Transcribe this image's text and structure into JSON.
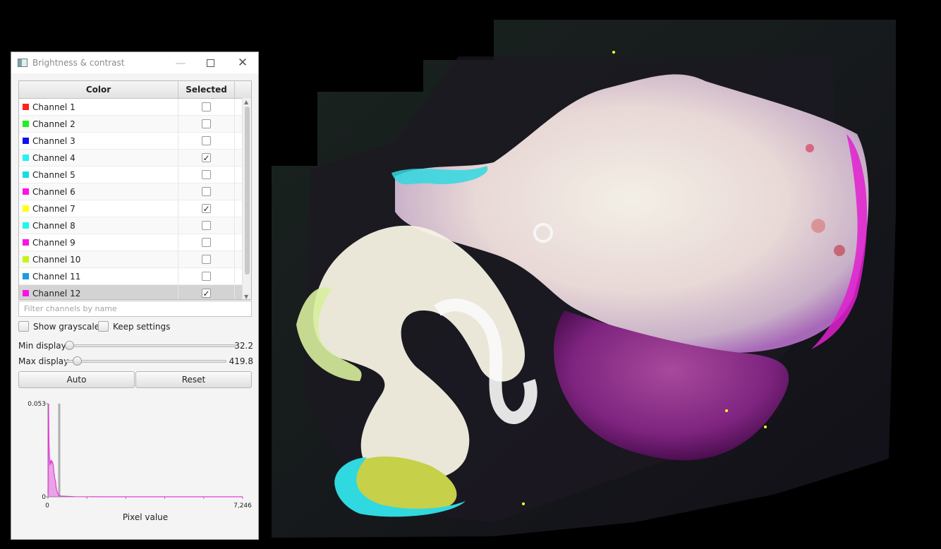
{
  "dialog": {
    "title": "Brightness & contrast",
    "minimize_icon": "minimize-icon",
    "maximize_icon": "maximize-icon",
    "close_icon": "close-icon",
    "table": {
      "headers": {
        "color": "Color",
        "selected": "Selected"
      },
      "rows": [
        {
          "name": "Channel 1",
          "color": "#ff2020",
          "selected": false
        },
        {
          "name": "Channel 2",
          "color": "#22ee22",
          "selected": false
        },
        {
          "name": "Channel 3",
          "color": "#1010ee",
          "selected": false
        },
        {
          "name": "Channel 4",
          "color": "#22f2f2",
          "selected": true
        },
        {
          "name": "Channel 5",
          "color": "#16dede",
          "selected": false
        },
        {
          "name": "Channel 6",
          "color": "#ff10e6",
          "selected": false
        },
        {
          "name": "Channel 7",
          "color": "#ffff10",
          "selected": true
        },
        {
          "name": "Channel 8",
          "color": "#22f5ee",
          "selected": false
        },
        {
          "name": "Channel 9",
          "color": "#ff10e6",
          "selected": false
        },
        {
          "name": "Channel 10",
          "color": "#c8f414",
          "selected": false
        },
        {
          "name": "Channel 11",
          "color": "#1d9be4",
          "selected": false
        },
        {
          "name": "Channel 12",
          "color": "#ff10e6",
          "selected": true
        }
      ]
    },
    "filter": {
      "value": "",
      "placeholder": "Filter channels by name"
    },
    "show_grayscale_label": "Show grayscale",
    "keep_settings_label": "Keep settings",
    "min_display": {
      "label": "Min display",
      "value": "32.2",
      "fraction": 0.0
    },
    "max_display": {
      "label": "Max display",
      "value": "419.8",
      "fraction": 0.05
    },
    "auto_label": "Auto",
    "reset_label": "Reset"
  },
  "chart_data": {
    "type": "area",
    "xlabel": "Pixel value",
    "ylabel": "",
    "xlim": [
      0,
      7246
    ],
    "ylim": [
      0,
      0.053
    ],
    "x_tick_labels": [
      "0",
      "7,246"
    ],
    "y_tick_labels": [
      "0",
      "0.053"
    ],
    "color": "#e040d8",
    "markers": [
      32.2,
      419.8
    ],
    "x": [
      0,
      20,
      40,
      60,
      80,
      100,
      120,
      140,
      160,
      180,
      200,
      220,
      240,
      260,
      280,
      300,
      320,
      340,
      360,
      380,
      400,
      450,
      500,
      1000,
      2000,
      3000,
      4000,
      5000,
      6000,
      7246
    ],
    "y": [
      0.002,
      0.053,
      0.03,
      0.022,
      0.018,
      0.02,
      0.021,
      0.019,
      0.02,
      0.019,
      0.018,
      0.014,
      0.012,
      0.01,
      0.009,
      0.006,
      0.004,
      0.003,
      0.002,
      0.0015,
      0.001,
      0.0006,
      0.0004,
      0.0001,
      0.0,
      0.0,
      0.0,
      0.0,
      0.0,
      0.0
    ]
  }
}
